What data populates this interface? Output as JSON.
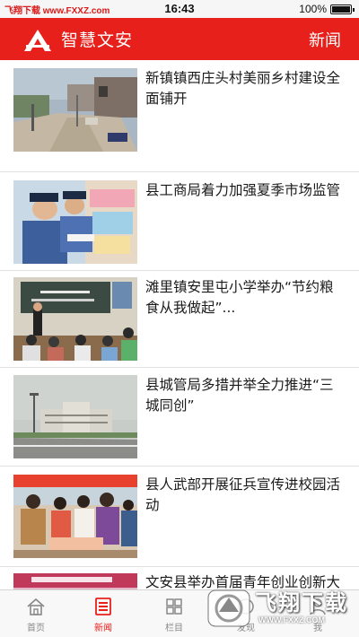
{
  "status_bar": {
    "watermark": "飞翔下载 www.FXXZ.com",
    "time": "16:43",
    "battery": "100%"
  },
  "header": {
    "app_title": "智慧文安",
    "section": "新闻"
  },
  "news": [
    {
      "title": "新镇镇西庄头村美丽乡村建设全面铺开"
    },
    {
      "title": "县工商局着力加强夏季市场监管"
    },
    {
      "title": "滩里镇安里屯小学举办“节约粮食从我做起”..."
    },
    {
      "title": "县城管局多措并举全力推进“三城同创”"
    },
    {
      "title": "县人武部开展征兵宣传进校园活动"
    },
    {
      "title": "文安县举办首届青年创业创新大"
    }
  ],
  "tabs": [
    {
      "label": "首页",
      "icon": "home-icon"
    },
    {
      "label": "新闻",
      "icon": "news-icon",
      "active": true
    },
    {
      "label": "栏目",
      "icon": "grid-icon"
    },
    {
      "label": "发现",
      "icon": "discover-icon"
    },
    {
      "label": "我",
      "icon": "profile-icon"
    }
  ],
  "watermark": {
    "name": "飞翔下载",
    "url": "WWW.FXXZ.COM"
  }
}
